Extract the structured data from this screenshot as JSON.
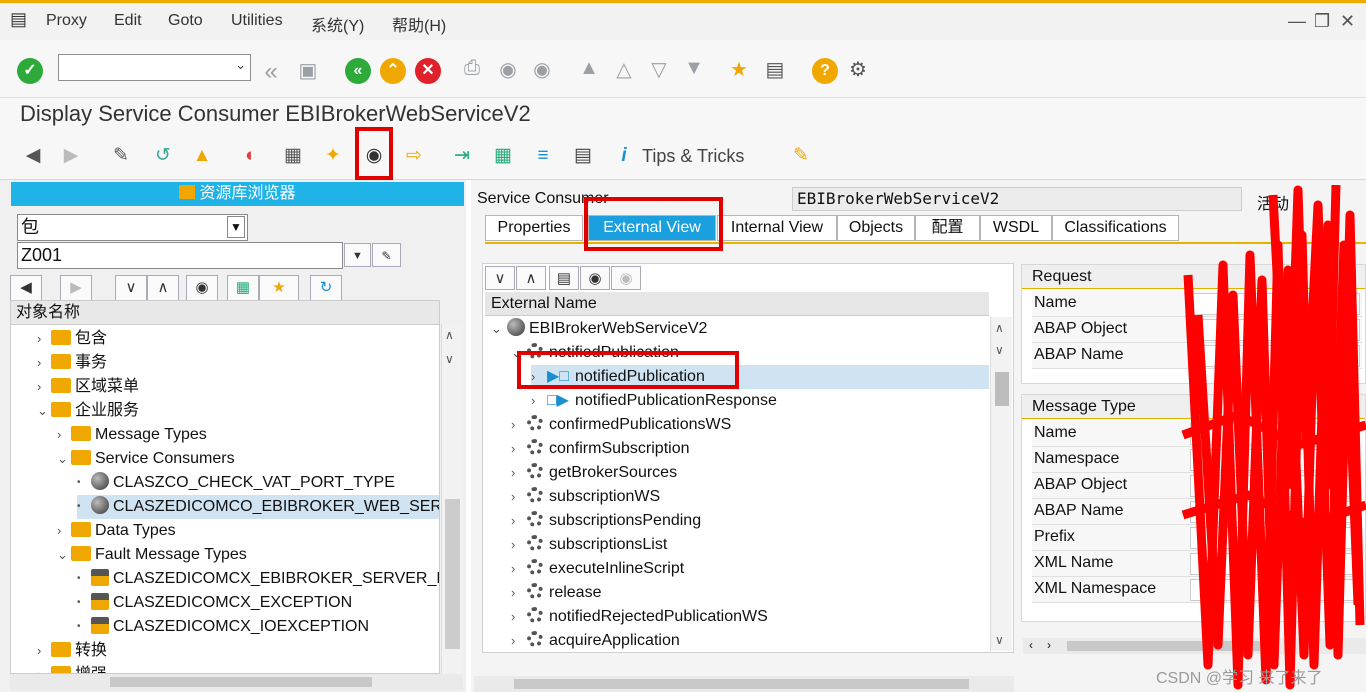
{
  "menu": {
    "items": [
      "Proxy",
      "Edit",
      "Goto",
      "Utilities",
      "系统(Y)",
      "帮助(H)"
    ],
    "window_controls": [
      "—",
      "❐",
      "✕"
    ]
  },
  "toolbar1": {
    "command_field_value": ""
  },
  "title": "Display Service Consumer EBIBrokerWebServiceV2",
  "toolbar2": {
    "tips_label": "Tips & Tricks"
  },
  "left": {
    "header": "资源库浏览器",
    "object_type_value": "包",
    "object_name_value": "Z001",
    "column_header": "对象名称",
    "tree": [
      {
        "label": "包含",
        "icon": "folder",
        "level": 0
      },
      {
        "label": "事务",
        "icon": "folder",
        "level": 0
      },
      {
        "label": "区域菜单",
        "icon": "folder",
        "level": 0
      },
      {
        "label": "企业服务",
        "icon": "folder-open",
        "level": 0
      },
      {
        "label": "Message Types",
        "icon": "folder",
        "level": 1
      },
      {
        "label": "Service Consumers",
        "icon": "folder-open",
        "level": 1
      },
      {
        "label": "CLASZCO_CHECK_VAT_PORT_TYPE",
        "icon": "service",
        "level": 2
      },
      {
        "label": "CLASZEDICOMCO_EBIBROKER_WEB_SERVI",
        "icon": "service",
        "level": 2
      },
      {
        "label": "Data Types",
        "icon": "folder",
        "level": 1
      },
      {
        "label": "Fault Message Types",
        "icon": "folder-open",
        "level": 1
      },
      {
        "label": "CLASZEDICOMCX_EBIBROKER_SERVER_EX",
        "icon": "class",
        "level": 2
      },
      {
        "label": "CLASZEDICOMCX_EXCEPTION",
        "icon": "class",
        "level": 2
      },
      {
        "label": "CLASZEDICOMCX_IOEXCEPTION",
        "icon": "class",
        "level": 2
      },
      {
        "label": "转换",
        "icon": "folder",
        "level": 0
      },
      {
        "label": "增强",
        "icon": "folder",
        "level": 0
      }
    ]
  },
  "right": {
    "consumer_label": "Service Consumer",
    "consumer_value": "EBIBrokerWebServiceV2",
    "status": "活动",
    "tabs": [
      "Properties",
      "External View",
      "Internal View",
      "Objects",
      "配置",
      "WSDL",
      "Classifications"
    ],
    "active_tab": "External View",
    "tree_header": "External Name",
    "tree": [
      {
        "label": "EBIBrokerWebServiceV2",
        "icon": "service",
        "level": 0
      },
      {
        "label": "notifiedPublication",
        "icon": "operation",
        "level": 1
      },
      {
        "label": "notifiedPublication",
        "icon": "request",
        "level": 2
      },
      {
        "label": "notifiedPublicationResponse",
        "icon": "response",
        "level": 2
      },
      {
        "label": "confirmedPublicationsWS",
        "icon": "operation",
        "level": 1
      },
      {
        "label": "confirmSubscription",
        "icon": "operation",
        "level": 1
      },
      {
        "label": "getBrokerSources",
        "icon": "operation",
        "level": 1
      },
      {
        "label": "subscriptionWS",
        "icon": "operation",
        "level": 1
      },
      {
        "label": "subscriptionsPending",
        "icon": "operation",
        "level": 1
      },
      {
        "label": "subscriptionsList",
        "icon": "operation",
        "level": 1
      },
      {
        "label": "executeInlineScript",
        "icon": "operation",
        "level": 1
      },
      {
        "label": "release",
        "icon": "operation",
        "level": 1
      },
      {
        "label": "notifiedRejectedPublicationWS",
        "icon": "operation",
        "level": 1
      },
      {
        "label": "acquireApplication",
        "icon": "operation",
        "level": 1
      }
    ],
    "request": {
      "title": "Request",
      "fields": [
        "Name",
        "ABAP Object",
        "ABAP Name"
      ]
    },
    "message_type": {
      "title": "Message Type",
      "fields": [
        "Name",
        "Namespace",
        "ABAP Object",
        "ABAP Name",
        "Prefix",
        "XML Name",
        "XML Namespace"
      ]
    }
  },
  "watermark": "CSDN @学习 来了来了"
}
